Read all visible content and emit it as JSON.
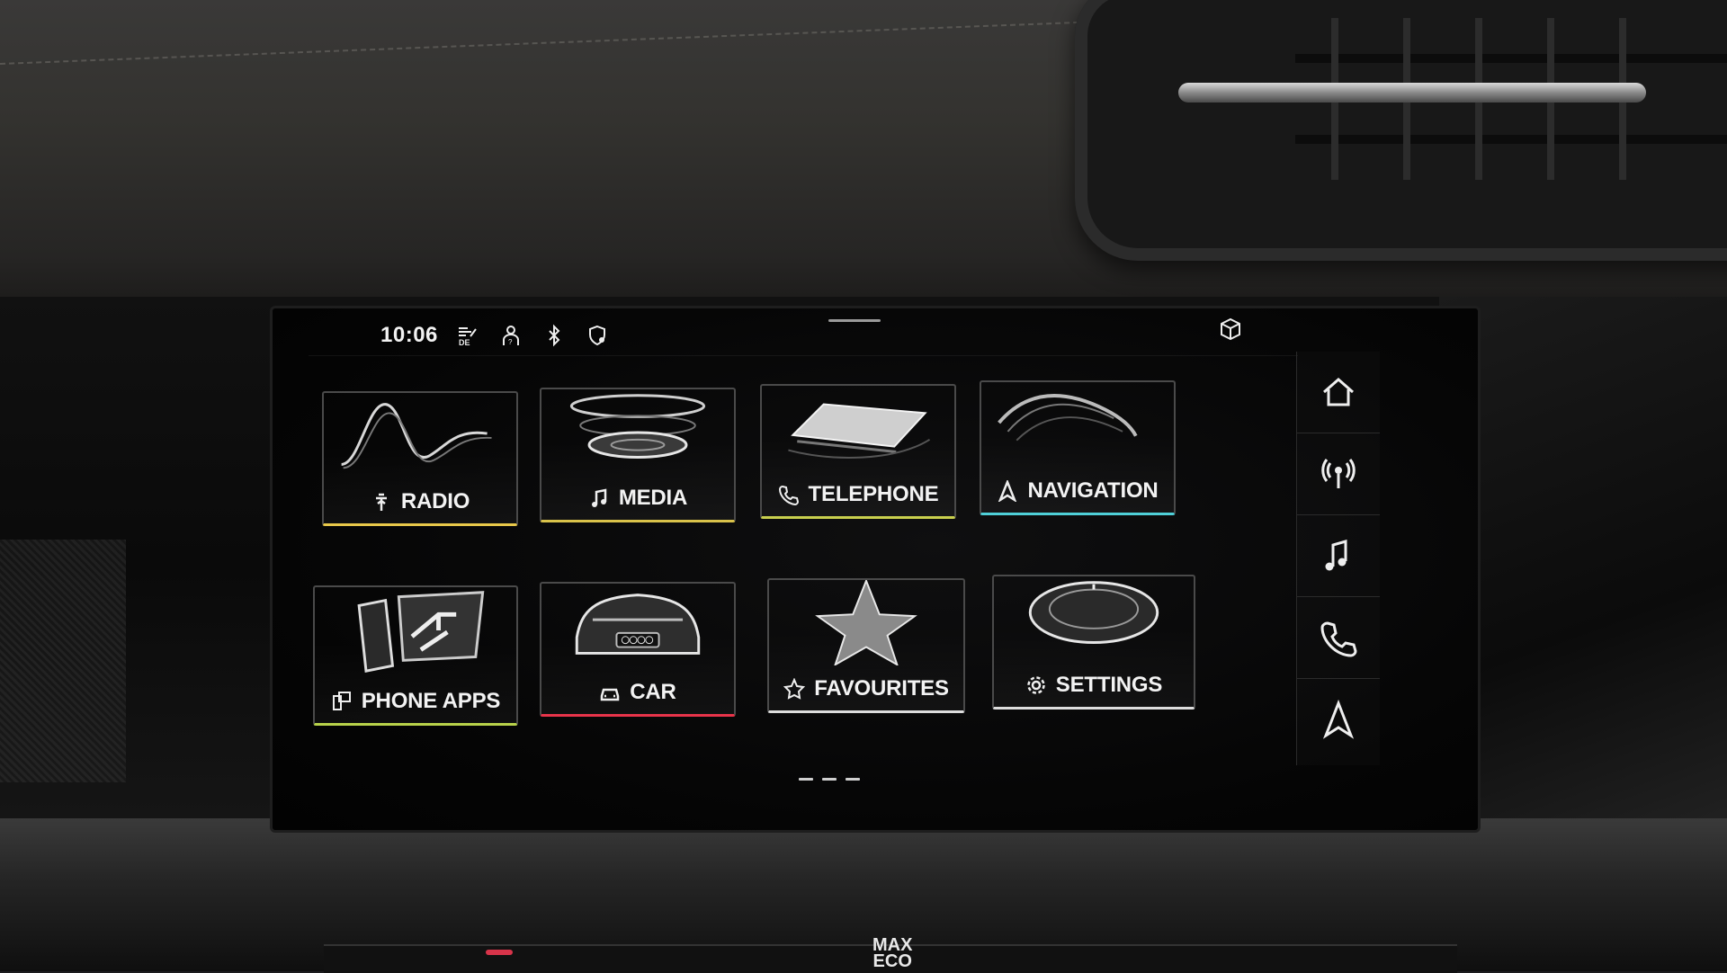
{
  "status_bar": {
    "time": "10:06",
    "icons": [
      "traffic-sign-de-icon",
      "driver-profile-icon",
      "bluetooth-icon",
      "privacy-location-icon"
    ],
    "right_icon": "package-cube-icon"
  },
  "tiles": [
    {
      "id": "radio",
      "label": "RADIO",
      "icon": "antenna-icon",
      "accent": "#e8c84a"
    },
    {
      "id": "media",
      "label": "MEDIA",
      "icon": "music-note-icon",
      "accent": "#d9c24a"
    },
    {
      "id": "telephone",
      "label": "TELEPHONE",
      "icon": "phone-icon",
      "accent": "#c9d04e"
    },
    {
      "id": "navigation",
      "label": "NAVIGATION",
      "icon": "navigation-arrow-icon",
      "accent": "#4fd0d8"
    },
    {
      "id": "phone-apps",
      "label": "PHONE APPS",
      "icon": "phone-apps-icon",
      "accent": "#b8d24a"
    },
    {
      "id": "car",
      "label": "CAR",
      "icon": "car-icon",
      "accent": "#e8344a"
    },
    {
      "id": "favourites",
      "label": "FAVOURITES",
      "icon": "star-icon",
      "accent": "#dddddd"
    },
    {
      "id": "settings",
      "label": "SETTINGS",
      "icon": "gear-icon",
      "accent": "#dddddd"
    }
  ],
  "pager": {
    "pages": 3,
    "current": 1
  },
  "rail": [
    {
      "id": "home",
      "icon": "home-icon"
    },
    {
      "id": "radio",
      "icon": "antenna-icon"
    },
    {
      "id": "media",
      "icon": "music-note-icon"
    },
    {
      "id": "telephone",
      "icon": "phone-icon"
    },
    {
      "id": "navigation",
      "icon": "navigation-arrow-icon"
    }
  ],
  "climate": {
    "eco_label": "MAX\nECO"
  }
}
